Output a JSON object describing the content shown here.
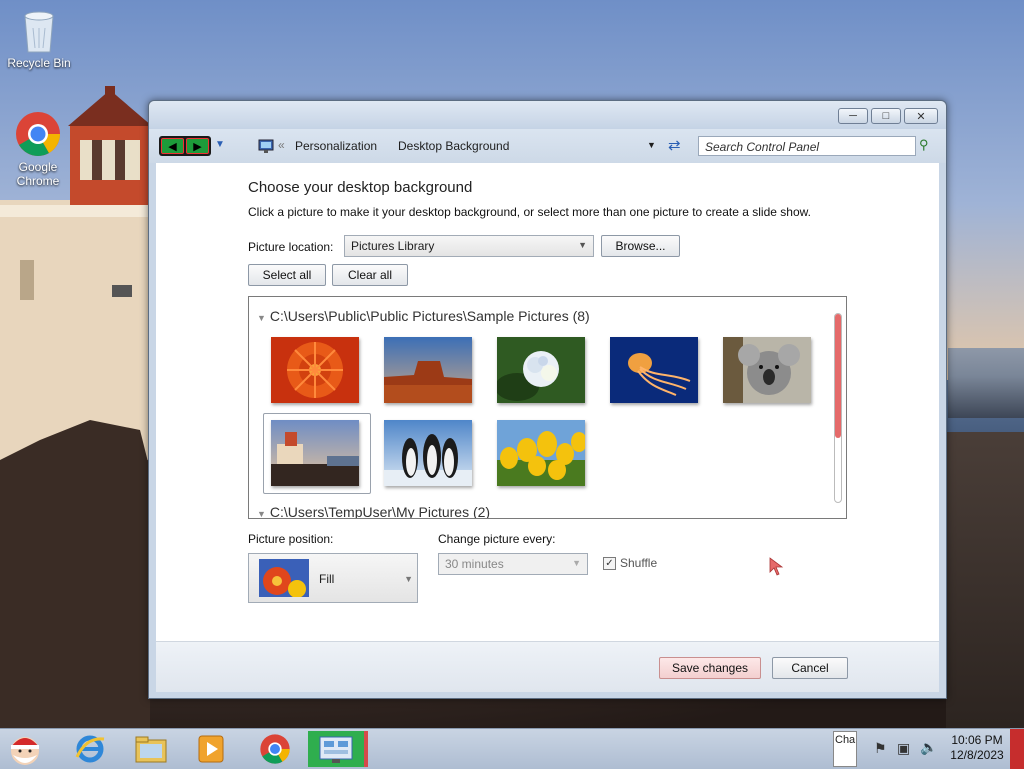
{
  "desktop": {
    "icons": [
      {
        "label": "Recycle Bin",
        "icon": "recycle-bin-icon"
      },
      {
        "label": "Google Chrome",
        "icon": "chrome-icon"
      }
    ]
  },
  "window": {
    "breadcrumb": [
      "Personalization",
      "Desktop Background"
    ],
    "search_placeholder": "Search Control Panel",
    "heading": "Choose your desktop background",
    "description": "Click a picture to make it your desktop background, or select more than one picture to create a slide show.",
    "picture_location_label": "Picture location:",
    "picture_location_value": "Pictures Library",
    "browse_label": "Browse...",
    "select_all_label": "Select all",
    "clear_all_label": "Clear all",
    "groups": [
      {
        "title": "C:\\Users\\Public\\Public Pictures\\Sample Pictures (8)",
        "pictures": [
          "Chrysanthemum",
          "Desert",
          "Hydrangeas",
          "Jellyfish",
          "Koala",
          "Lighthouse",
          "Penguins",
          "Tulips"
        ]
      },
      {
        "title": "C:\\Users\\TempUser\\My Pictures (2)"
      }
    ],
    "picture_position_label": "Picture position:",
    "picture_position_value": "Fill",
    "change_every_label": "Change picture every:",
    "change_every_value": "30 minutes",
    "shuffle_label": "Shuffle",
    "shuffle_checked": true,
    "save_label": "Save changes",
    "cancel_label": "Cancel"
  },
  "taskbar": {
    "apps": [
      "santa-app-icon",
      "internet-explorer-icon",
      "file-explorer-icon",
      "media-player-icon",
      "chrome-icon",
      "control-panel-icon"
    ],
    "tray_label": "Cha",
    "time": "10:06 PM",
    "date": "12/8/2023"
  },
  "colors": {
    "accent_red": "#e56a6a",
    "window_frame": "#c9d6e6"
  }
}
